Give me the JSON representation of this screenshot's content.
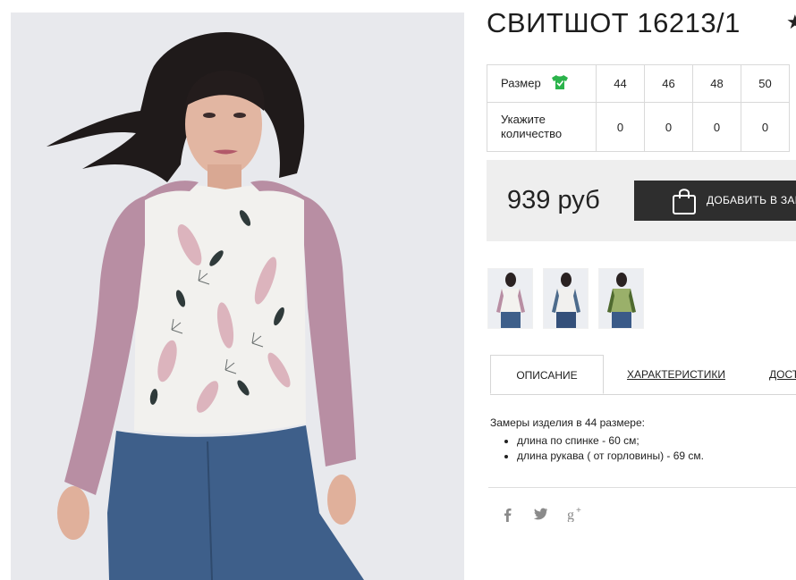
{
  "product": {
    "title": "СВИТШОТ 16213/1",
    "favorite_icon": "star-icon"
  },
  "sizes": {
    "size_label": "Размер",
    "size_icon": "tshirt-icon",
    "qty_label_line1": "Укажите",
    "qty_label_line2": "количество",
    "items": [
      {
        "size": "44",
        "qty": "0"
      },
      {
        "size": "46",
        "qty": "0"
      },
      {
        "size": "48",
        "qty": "0"
      },
      {
        "size": "50",
        "qty": "0"
      }
    ]
  },
  "buy": {
    "price": "939 руб",
    "add_label": "ДОБАВИТЬ В ЗАКАЗ",
    "bag_icon": "shopping-bag-icon"
  },
  "tabs": [
    {
      "label": "ОПИСАНИЕ",
      "active": true
    },
    {
      "label": "ХАРАКТЕРИСТИКИ",
      "active": false
    },
    {
      "label": "ДОСТАВКА",
      "active": false
    }
  ],
  "description": {
    "intro": "Замеры изделия в 44 размере:",
    "items": [
      "длина по спинке - 60 см;",
      "длина рукава ( от горловины) - 69 см."
    ]
  },
  "social": [
    {
      "icon": "facebook-icon",
      "glyph": "f"
    },
    {
      "icon": "twitter-icon",
      "glyph": "t"
    },
    {
      "icon": "google-plus-icon",
      "glyph": "g+"
    }
  ],
  "colors": {
    "accent_green": "#2bb34b",
    "button_dark": "#2e2e2e",
    "buybar_bg": "#eeeeee",
    "sleeve_pink": "#b58a9f",
    "jeans_blue": "#3e5f8a"
  }
}
